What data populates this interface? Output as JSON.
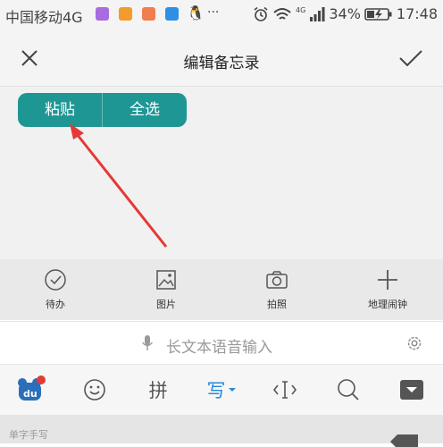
{
  "status_bar": {
    "carrier": "中国移动4G",
    "more": "···",
    "network": "4G",
    "battery": "34%",
    "time": "17:48"
  },
  "header": {
    "title": "编辑备忘录"
  },
  "popup": {
    "paste": "粘贴",
    "select_all": "全选"
  },
  "toolbar": {
    "items": [
      {
        "label": "待办",
        "icon": "checkmark-circle-icon"
      },
      {
        "label": "图片",
        "icon": "image-icon"
      },
      {
        "label": "拍照",
        "icon": "camera-icon"
      },
      {
        "label": "地理闹钟",
        "icon": "plus-icon"
      }
    ]
  },
  "voice_bar": {
    "label": "长文本语音输入"
  },
  "ime": {
    "logo": "du",
    "pinyin": "拼",
    "write": "写"
  },
  "handwriting": {
    "label": "单字手写"
  },
  "colors": {
    "accent": "#1e9694",
    "arrow": "#e53935",
    "write_active": "#2a88d8"
  }
}
